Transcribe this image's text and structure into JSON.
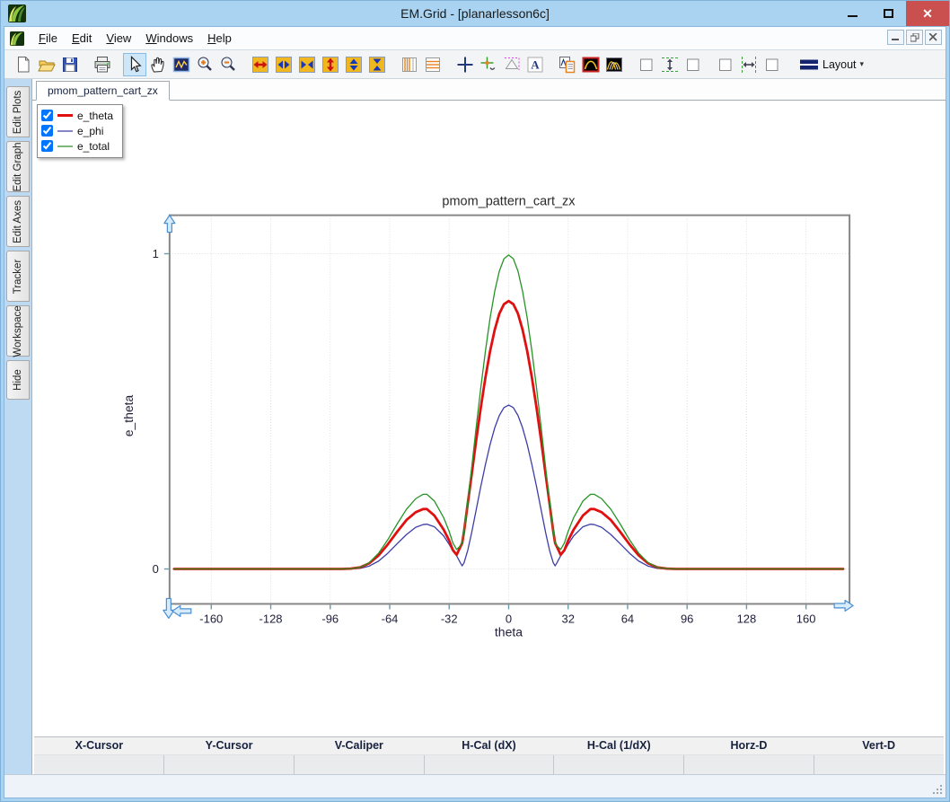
{
  "window": {
    "title": "EM.Grid - [planarlesson6c]"
  },
  "menu_bar": {
    "items": [
      "File",
      "Edit",
      "View",
      "Windows",
      "Help"
    ]
  },
  "toolbar": {
    "buttons": [
      {
        "name": "new-file"
      },
      {
        "name": "open-file"
      },
      {
        "name": "save"
      },
      {
        "name": "print",
        "gap": true
      },
      {
        "name": "select-arrow",
        "selected": true,
        "gap": true
      },
      {
        "name": "pan-hand"
      },
      {
        "name": "zoom-window"
      },
      {
        "name": "zoom-in"
      },
      {
        "name": "zoom-out"
      },
      {
        "name": "stretch-horizontal",
        "gap": true
      },
      {
        "name": "expand-horizontal"
      },
      {
        "name": "shrink-horizontal"
      },
      {
        "name": "stretch-vertical"
      },
      {
        "name": "expand-vertical"
      },
      {
        "name": "shrink-vertical"
      },
      {
        "name": "vertical-gridlines",
        "gap": true
      },
      {
        "name": "horizontal-gridlines"
      },
      {
        "name": "crosshair-cursor",
        "gap": true
      },
      {
        "name": "tracker-cursor"
      },
      {
        "name": "caliper"
      },
      {
        "name": "text-annotation"
      },
      {
        "name": "plot-properties",
        "gap": true
      },
      {
        "name": "graph-style-single"
      },
      {
        "name": "graph-style-multi"
      },
      {
        "name": "sync-box-a",
        "gap": true
      },
      {
        "name": "sync-vertical"
      },
      {
        "name": "sync-box-b"
      },
      {
        "name": "sync-box-c",
        "gap": true
      },
      {
        "name": "sync-horizontal"
      },
      {
        "name": "sync-box-d"
      },
      {
        "name": "layout-menu",
        "gap": true,
        "label": "Layout"
      }
    ]
  },
  "sidebar": {
    "tabs": [
      "Edit Plots",
      "Edit Graph",
      "Edit Axes",
      "Tracker",
      "Workspace",
      "Hide"
    ]
  },
  "tabs": {
    "active": "pmom_pattern_cart_zx"
  },
  "legend": {
    "items": [
      {
        "label": "e_theta",
        "checked": true,
        "color": "#e01010",
        "weight": 3
      },
      {
        "label": "e_phi",
        "checked": true,
        "color": "#8585c8",
        "weight": 2
      },
      {
        "label": "e_total",
        "checked": true,
        "color": "#7cb87c",
        "weight": 2
      }
    ]
  },
  "chart_data": {
    "type": "line",
    "title": "pmom_pattern_cart_zx",
    "xlabel": "theta",
    "ylabel": "e_theta",
    "xlim": [
      -183,
      183
    ],
    "ylim": [
      -0.11,
      1.12
    ],
    "xticks": [
      -160,
      -128,
      -96,
      -64,
      -32,
      0,
      32,
      64,
      96,
      128,
      160
    ],
    "yticks": [
      0,
      1
    ],
    "grid": true,
    "legend_position": "top-left",
    "draw_order": [
      1,
      0,
      2
    ],
    "x": [
      -180,
      -150,
      -120,
      -100,
      -90,
      -85,
      -80,
      -75,
      -70,
      -65,
      -60,
      -55,
      -50,
      -46,
      -44,
      -40,
      -35,
      -32,
      -30,
      -28,
      -26,
      -25,
      -24,
      -22,
      -20,
      -17.5,
      -15,
      -12.5,
      -10,
      -7.5,
      -5,
      -2.5,
      0,
      2.5,
      5,
      7.5,
      10,
      12.5,
      15,
      17.5,
      20,
      22,
      24,
      25,
      26,
      28,
      30,
      32,
      35,
      40,
      44,
      46,
      50,
      55,
      60,
      65,
      70,
      75,
      80,
      85,
      90,
      100,
      120,
      150,
      180
    ],
    "series": [
      {
        "name": "e_theta",
        "color": "#e01010",
        "width": 2.8,
        "values": [
          0,
          0,
          0,
          0,
          0,
          0.001,
          0.005,
          0.018,
          0.043,
          0.078,
          0.118,
          0.155,
          0.18,
          0.19,
          0.19,
          0.17,
          0.125,
          0.09,
          0.06,
          0.045,
          0.07,
          0.082,
          0.12,
          0.208,
          0.296,
          0.406,
          0.511,
          0.607,
          0.691,
          0.759,
          0.81,
          0.84,
          0.85,
          0.84,
          0.81,
          0.759,
          0.691,
          0.607,
          0.511,
          0.406,
          0.296,
          0.208,
          0.12,
          0.082,
          0.07,
          0.045,
          0.06,
          0.09,
          0.125,
          0.17,
          0.19,
          0.19,
          0.18,
          0.155,
          0.118,
          0.078,
          0.043,
          0.018,
          0.005,
          0.001,
          0,
          0,
          0,
          0,
          0
        ]
      },
      {
        "name": "e_phi",
        "color": "#3d3da8",
        "width": 1.3,
        "values": [
          0,
          0,
          0,
          0,
          0,
          0,
          0.002,
          0.009,
          0.025,
          0.05,
          0.08,
          0.109,
          0.132,
          0.141,
          0.142,
          0.134,
          0.105,
          0.078,
          0.057,
          0.042,
          0.02,
          0.01,
          0.02,
          0.059,
          0.113,
          0.186,
          0.261,
          0.331,
          0.395,
          0.448,
          0.487,
          0.512,
          0.52,
          0.512,
          0.487,
          0.448,
          0.395,
          0.331,
          0.261,
          0.186,
          0.113,
          0.059,
          0.02,
          0.01,
          0.02,
          0.042,
          0.057,
          0.078,
          0.105,
          0.134,
          0.142,
          0.141,
          0.132,
          0.109,
          0.08,
          0.05,
          0.025,
          0.009,
          0.002,
          0,
          0,
          0,
          0,
          0,
          0
        ]
      },
      {
        "name": "e_total",
        "color": "#259425",
        "width": 1.3,
        "values": [
          0,
          0,
          0,
          0,
          0,
          0.001,
          0.005,
          0.02,
          0.05,
          0.093,
          0.143,
          0.189,
          0.223,
          0.237,
          0.237,
          0.216,
          0.163,
          0.119,
          0.083,
          0.062,
          0.073,
          0.083,
          0.122,
          0.216,
          0.317,
          0.447,
          0.574,
          0.691,
          0.796,
          0.881,
          0.945,
          0.984,
          0.996,
          0.984,
          0.945,
          0.881,
          0.796,
          0.691,
          0.574,
          0.447,
          0.317,
          0.216,
          0.122,
          0.083,
          0.073,
          0.062,
          0.083,
          0.119,
          0.163,
          0.216,
          0.237,
          0.237,
          0.223,
          0.189,
          0.143,
          0.093,
          0.05,
          0.02,
          0.005,
          0.001,
          0,
          0,
          0,
          0,
          0
        ]
      }
    ]
  },
  "readout": {
    "columns": [
      "X-Cursor",
      "Y-Cursor",
      "V-Caliper",
      "H-Cal (dX)",
      "H-Cal (1/dX)",
      "Horz-D",
      "Vert-D"
    ],
    "values": [
      "",
      "",
      "",
      "",
      "",
      "",
      ""
    ]
  }
}
